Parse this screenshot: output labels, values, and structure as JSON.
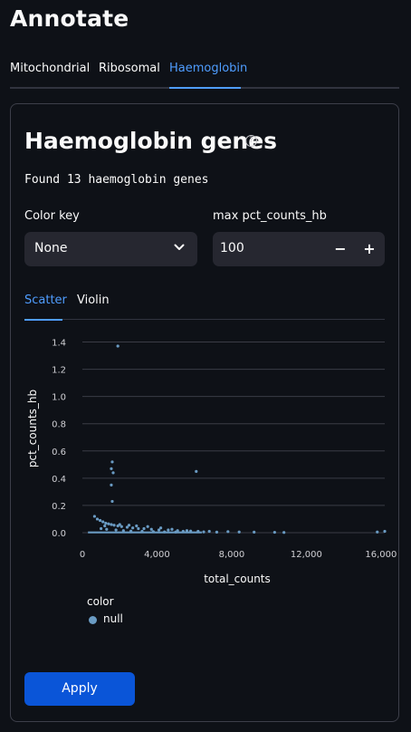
{
  "app": {
    "title": "Annotate"
  },
  "tabs": [
    {
      "label": "Mitochondrial"
    },
    {
      "label": "Ribosomal"
    },
    {
      "label": "Haemoglobin",
      "active": true
    }
  ],
  "section": {
    "title": "Haemoglobin genes",
    "help_icon": "question-circle-icon",
    "found_text": "Found 13 haemoglobin genes"
  },
  "color_key": {
    "label": "Color key",
    "value": "None",
    "icon": "chevron-down-icon"
  },
  "max_pct": {
    "label": "max pct_counts_hb",
    "value": "100",
    "decrement": "−",
    "increment": "+"
  },
  "subtabs": [
    {
      "label": "Scatter",
      "active": true
    },
    {
      "label": "Violin"
    }
  ],
  "chart_data": {
    "type": "scatter",
    "xlabel": "total_counts",
    "ylabel": "pct_counts_hb",
    "x_ticks": [
      {
        "value": 0,
        "label": "0"
      },
      {
        "value": 4000,
        "label": "4,000"
      },
      {
        "value": 8000,
        "label": "8,000"
      },
      {
        "value": 12000,
        "label": "12,000"
      },
      {
        "value": 16000,
        "label": "16,000"
      }
    ],
    "y_ticks": [
      {
        "value": 0.0,
        "label": "0.0"
      },
      {
        "value": 0.2,
        "label": "0.2"
      },
      {
        "value": 0.4,
        "label": "0.4"
      },
      {
        "value": 0.6,
        "label": "0.6"
      },
      {
        "value": 0.8,
        "label": "0.8"
      },
      {
        "value": 1.0,
        "label": "1.0"
      },
      {
        "value": 1.2,
        "label": "1.2"
      },
      {
        "value": 1.4,
        "label": "1.4"
      }
    ],
    "xlim": [
      0,
      16200
    ],
    "ylim": [
      -0.02,
      1.47
    ],
    "grid": true,
    "legend": {
      "title": "color",
      "entries": [
        {
          "name": "null",
          "color": "#6a9bc3"
        }
      ]
    },
    "series": [
      {
        "name": "null",
        "color": "#6a9bc3",
        "points": [
          [
            1900,
            1.37
          ],
          [
            1600,
            0.52
          ],
          [
            1550,
            0.47
          ],
          [
            1650,
            0.44
          ],
          [
            1550,
            0.35
          ],
          [
            1600,
            0.23
          ],
          [
            6100,
            0.45
          ],
          [
            650,
            0.12
          ],
          [
            800,
            0.1
          ],
          [
            950,
            0.09
          ],
          [
            1100,
            0.08
          ],
          [
            1250,
            0.07
          ],
          [
            1400,
            0.065
          ],
          [
            1550,
            0.06
          ],
          [
            1700,
            0.055
          ],
          [
            1900,
            0.05
          ],
          [
            2100,
            0.045
          ],
          [
            2400,
            0.04
          ],
          [
            2700,
            0.035
          ],
          [
            3000,
            0.03
          ],
          [
            3300,
            0.03
          ],
          [
            3700,
            0.025
          ],
          [
            4100,
            0.02
          ],
          [
            4600,
            0.02
          ],
          [
            5100,
            0.015
          ],
          [
            5600,
            0.015
          ],
          [
            6200,
            0.01
          ],
          [
            6800,
            0.01
          ],
          [
            7800,
            0.008
          ],
          [
            8400,
            0.005
          ],
          [
            9200,
            0.004
          ],
          [
            10300,
            0.003
          ],
          [
            10800,
            0.002
          ],
          [
            15800,
            0.005
          ],
          [
            16200,
            0.01
          ],
          [
            1000,
            0.03
          ],
          [
            1300,
            0.025
          ],
          [
            1800,
            0.02
          ],
          [
            2200,
            0.015
          ],
          [
            2600,
            0.012
          ],
          [
            3200,
            0.01
          ],
          [
            3800,
            0.008
          ],
          [
            4400,
            0.006
          ],
          [
            5000,
            0.005
          ],
          [
            5400,
            0.01
          ],
          [
            5800,
            0.012
          ],
          [
            6500,
            0.006
          ],
          [
            7200,
            0.004
          ],
          [
            3500,
            0.045
          ],
          [
            2900,
            0.05
          ],
          [
            4200,
            0.035
          ],
          [
            4800,
            0.025
          ],
          [
            1200,
            0.05
          ],
          [
            2000,
            0.06
          ],
          [
            2500,
            0.055
          ]
        ]
      }
    ]
  },
  "actions": {
    "apply_label": "Apply"
  }
}
